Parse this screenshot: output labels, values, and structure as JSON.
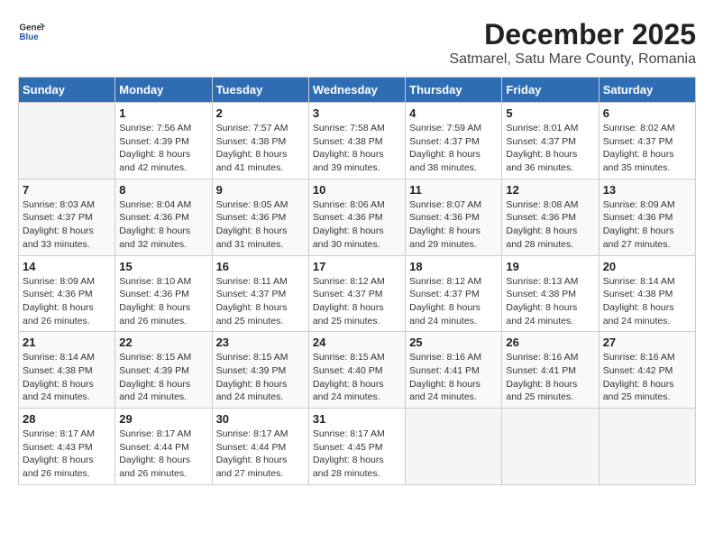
{
  "logo": {
    "text_general": "General",
    "text_blue": "Blue"
  },
  "title": "December 2025",
  "subtitle": "Satmarel, Satu Mare County, Romania",
  "headers": [
    "Sunday",
    "Monday",
    "Tuesday",
    "Wednesday",
    "Thursday",
    "Friday",
    "Saturday"
  ],
  "weeks": [
    [
      {
        "day": "",
        "info": ""
      },
      {
        "day": "1",
        "info": "Sunrise: 7:56 AM\nSunset: 4:39 PM\nDaylight: 8 hours\nand 42 minutes."
      },
      {
        "day": "2",
        "info": "Sunrise: 7:57 AM\nSunset: 4:38 PM\nDaylight: 8 hours\nand 41 minutes."
      },
      {
        "day": "3",
        "info": "Sunrise: 7:58 AM\nSunset: 4:38 PM\nDaylight: 8 hours\nand 39 minutes."
      },
      {
        "day": "4",
        "info": "Sunrise: 7:59 AM\nSunset: 4:37 PM\nDaylight: 8 hours\nand 38 minutes."
      },
      {
        "day": "5",
        "info": "Sunrise: 8:01 AM\nSunset: 4:37 PM\nDaylight: 8 hours\nand 36 minutes."
      },
      {
        "day": "6",
        "info": "Sunrise: 8:02 AM\nSunset: 4:37 PM\nDaylight: 8 hours\nand 35 minutes."
      }
    ],
    [
      {
        "day": "7",
        "info": ""
      },
      {
        "day": "8",
        "info": "Sunrise: 8:04 AM\nSunset: 4:36 PM\nDaylight: 8 hours\nand 32 minutes."
      },
      {
        "day": "9",
        "info": "Sunrise: 8:05 AM\nSunset: 4:36 PM\nDaylight: 8 hours\nand 31 minutes."
      },
      {
        "day": "10",
        "info": "Sunrise: 8:06 AM\nSunset: 4:36 PM\nDaylight: 8 hours\nand 30 minutes."
      },
      {
        "day": "11",
        "info": "Sunrise: 8:07 AM\nSunset: 4:36 PM\nDaylight: 8 hours\nand 29 minutes."
      },
      {
        "day": "12",
        "info": "Sunrise: 8:08 AM\nSunset: 4:36 PM\nDaylight: 8 hours\nand 28 minutes."
      },
      {
        "day": "13",
        "info": "Sunrise: 8:09 AM\nSunset: 4:36 PM\nDaylight: 8 hours\nand 27 minutes."
      }
    ],
    [
      {
        "day": "14",
        "info": ""
      },
      {
        "day": "15",
        "info": "Sunrise: 8:10 AM\nSunset: 4:36 PM\nDaylight: 8 hours\nand 26 minutes."
      },
      {
        "day": "16",
        "info": "Sunrise: 8:11 AM\nSunset: 4:37 PM\nDaylight: 8 hours\nand 25 minutes."
      },
      {
        "day": "17",
        "info": "Sunrise: 8:12 AM\nSunset: 4:37 PM\nDaylight: 8 hours\nand 25 minutes."
      },
      {
        "day": "18",
        "info": "Sunrise: 8:12 AM\nSunset: 4:37 PM\nDaylight: 8 hours\nand 24 minutes."
      },
      {
        "day": "19",
        "info": "Sunrise: 8:13 AM\nSunset: 4:38 PM\nDaylight: 8 hours\nand 24 minutes."
      },
      {
        "day": "20",
        "info": "Sunrise: 8:14 AM\nSunset: 4:38 PM\nDaylight: 8 hours\nand 24 minutes."
      }
    ],
    [
      {
        "day": "21",
        "info": ""
      },
      {
        "day": "22",
        "info": "Sunrise: 8:15 AM\nSunset: 4:39 PM\nDaylight: 8 hours\nand 24 minutes."
      },
      {
        "day": "23",
        "info": "Sunrise: 8:15 AM\nSunset: 4:39 PM\nDaylight: 8 hours\nand 24 minutes."
      },
      {
        "day": "24",
        "info": "Sunrise: 8:15 AM\nSunset: 4:40 PM\nDaylight: 8 hours\nand 24 minutes."
      },
      {
        "day": "25",
        "info": "Sunrise: 8:16 AM\nSunset: 4:41 PM\nDaylight: 8 hours\nand 24 minutes."
      },
      {
        "day": "26",
        "info": "Sunrise: 8:16 AM\nSunset: 4:41 PM\nDaylight: 8 hours\nand 25 minutes."
      },
      {
        "day": "27",
        "info": "Sunrise: 8:16 AM\nSunset: 4:42 PM\nDaylight: 8 hours\nand 25 minutes."
      }
    ],
    [
      {
        "day": "28",
        "info": "Sunrise: 8:17 AM\nSunset: 4:43 PM\nDaylight: 8 hours\nand 26 minutes."
      },
      {
        "day": "29",
        "info": "Sunrise: 8:17 AM\nSunset: 4:44 PM\nDaylight: 8 hours\nand 26 minutes."
      },
      {
        "day": "30",
        "info": "Sunrise: 8:17 AM\nSunset: 4:44 PM\nDaylight: 8 hours\nand 27 minutes."
      },
      {
        "day": "31",
        "info": "Sunrise: 8:17 AM\nSunset: 4:45 PM\nDaylight: 8 hours\nand 28 minutes."
      },
      {
        "day": "",
        "info": ""
      },
      {
        "day": "",
        "info": ""
      },
      {
        "day": "",
        "info": ""
      }
    ]
  ],
  "week7_sunday": {
    "day": "7",
    "info": "Sunrise: 8:03 AM\nSunset: 4:37 PM\nDaylight: 8 hours\nand 33 minutes."
  },
  "week14_sunday": {
    "day": "14",
    "info": "Sunrise: 8:09 AM\nSunset: 4:36 PM\nDaylight: 8 hours\nand 26 minutes."
  },
  "week21_sunday": {
    "day": "21",
    "info": "Sunrise: 8:14 AM\nSunset: 4:38 PM\nDaylight: 8 hours\nand 24 minutes."
  }
}
